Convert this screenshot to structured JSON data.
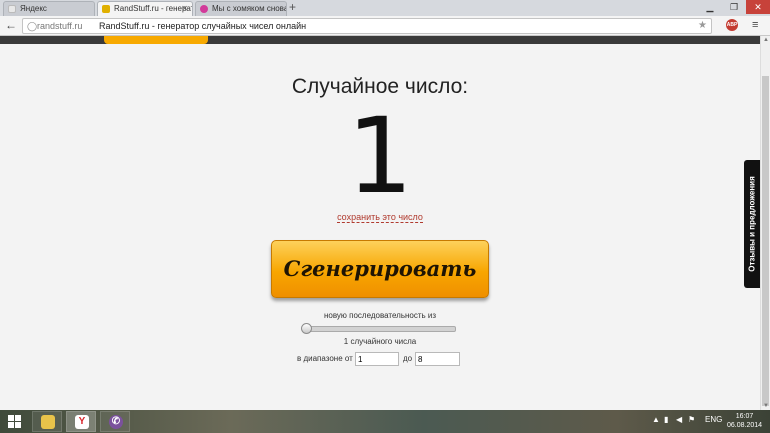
{
  "browser": {
    "tabs": [
      {
        "label": "Яндекс",
        "fav_color": "#e8e8e8"
      },
      {
        "label": "RandStuff.ru - генерат",
        "fav_color": "#e0b000"
      },
      {
        "label": "Мы с хомяком снова",
        "fav_color": "#d23a9a"
      }
    ],
    "newtab": "+",
    "address": {
      "domain": "randstuff.ru",
      "page_title": "RandStuff.ru - генератор случайных чисел онлайн"
    },
    "abp_label": "ABP"
  },
  "page": {
    "heading": "Случайное число:",
    "number": "1",
    "save_link": "сохранить это число",
    "generate_label": "Сгенерировать",
    "sequence_label": "новую последовательность из",
    "slider": {
      "value": 1,
      "min": 1,
      "max": 100
    },
    "count_label": "1 случайного числа",
    "range": {
      "from_label": "в диапазоне от",
      "from_value": "1",
      "to_label": "до",
      "to_value": "8"
    },
    "feedback_label": "Отзывы и предложения",
    "brand_color": "#f8a600"
  },
  "taskbar": {
    "lang": "ENG",
    "time": "16:07",
    "date": "06.08.2014"
  }
}
